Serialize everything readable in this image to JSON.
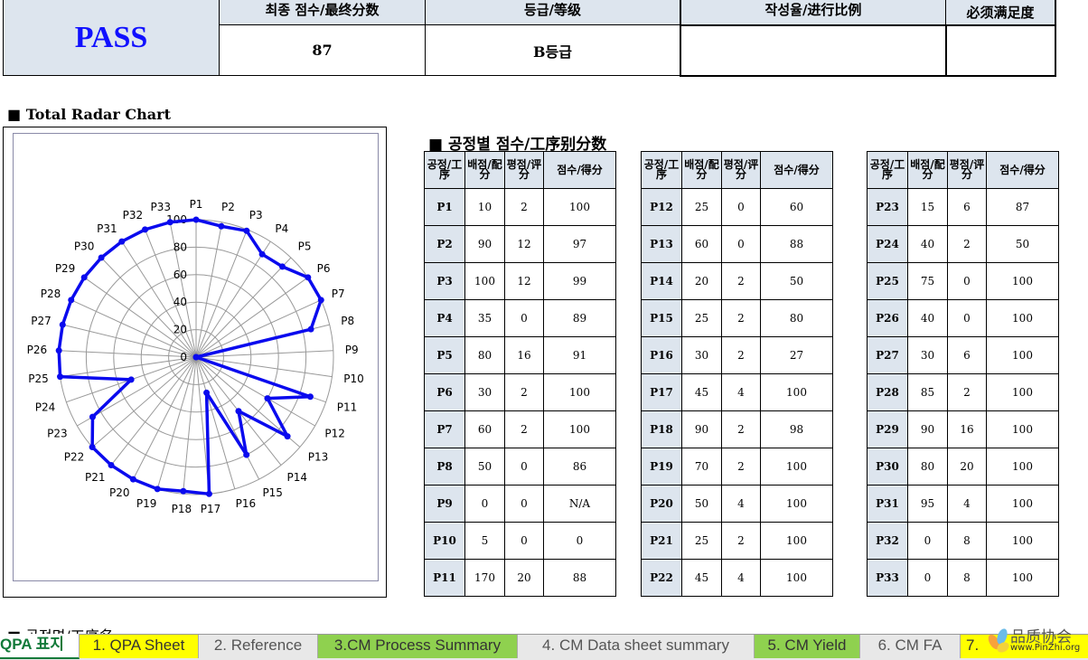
{
  "header": {
    "result": "PASS",
    "columns": [
      "최종 점수/最终分数",
      "등급/等级",
      "작성율/进行比例",
      "必须满足度"
    ],
    "values": [
      "87",
      "B등급",
      "",
      ""
    ]
  },
  "radar_title": "■ Total Radar Chart",
  "score_title": "■ 공정별 점수/工序别分数",
  "next_section": "■ 공정명/工序名",
  "table_headers": [
    "공정/工序",
    "배점/配分",
    "평점/评分",
    "점수/得分"
  ],
  "rows": [
    [
      "P1",
      "10",
      "2",
      "100"
    ],
    [
      "P2",
      "90",
      "12",
      "97"
    ],
    [
      "P3",
      "100",
      "12",
      "99"
    ],
    [
      "P4",
      "35",
      "0",
      "89"
    ],
    [
      "P5",
      "80",
      "16",
      "91"
    ],
    [
      "P6",
      "30",
      "2",
      "100"
    ],
    [
      "P7",
      "60",
      "2",
      "100"
    ],
    [
      "P8",
      "50",
      "0",
      "86"
    ],
    [
      "P9",
      "0",
      "0",
      "N/A"
    ],
    [
      "P10",
      "5",
      "0",
      "0"
    ],
    [
      "P11",
      "170",
      "20",
      "88"
    ],
    [
      "P12",
      "25",
      "0",
      "60"
    ],
    [
      "P13",
      "60",
      "0",
      "88"
    ],
    [
      "P14",
      "20",
      "2",
      "50"
    ],
    [
      "P15",
      "25",
      "2",
      "80"
    ],
    [
      "P16",
      "30",
      "2",
      "27"
    ],
    [
      "P17",
      "45",
      "4",
      "100"
    ],
    [
      "P18",
      "90",
      "2",
      "98"
    ],
    [
      "P19",
      "70",
      "2",
      "100"
    ],
    [
      "P20",
      "50",
      "4",
      "100"
    ],
    [
      "P21",
      "25",
      "2",
      "100"
    ],
    [
      "P22",
      "45",
      "4",
      "100"
    ],
    [
      "P23",
      "15",
      "6",
      "87"
    ],
    [
      "P24",
      "40",
      "2",
      "50"
    ],
    [
      "P25",
      "75",
      "0",
      "100"
    ],
    [
      "P26",
      "40",
      "0",
      "100"
    ],
    [
      "P27",
      "30",
      "6",
      "100"
    ],
    [
      "P28",
      "85",
      "2",
      "100"
    ],
    [
      "P29",
      "90",
      "16",
      "100"
    ],
    [
      "P30",
      "80",
      "20",
      "100"
    ],
    [
      "P31",
      "95",
      "4",
      "100"
    ],
    [
      "P32",
      "0",
      "8",
      "100"
    ],
    [
      "P33",
      "0",
      "8",
      "100"
    ]
  ],
  "chart_data": {
    "type": "radar",
    "categories": [
      "P1",
      "P2",
      "P3",
      "P4",
      "P5",
      "P6",
      "P7",
      "P8",
      "P9",
      "P10",
      "P11",
      "P12",
      "P13",
      "P14",
      "P15",
      "P16",
      "P17",
      "P18",
      "P19",
      "P20",
      "P21",
      "P22",
      "P23",
      "P24",
      "P25",
      "P26",
      "P27",
      "P28",
      "P29",
      "P30",
      "P31",
      "P32",
      "P33"
    ],
    "values": [
      100,
      97,
      99,
      89,
      91,
      100,
      100,
      86,
      0,
      0,
      88,
      60,
      88,
      50,
      80,
      27,
      100,
      98,
      100,
      100,
      100,
      100,
      87,
      50,
      100,
      100,
      100,
      100,
      100,
      100,
      100,
      100,
      100
    ],
    "rlim": [
      0,
      100
    ],
    "ticks": [
      "0",
      "20",
      "40",
      "60",
      "80",
      "100"
    ],
    "grid": true,
    "line_color": "#0a0aee"
  },
  "tabs": [
    {
      "label": "QPA 표지",
      "bg": "#ffffff",
      "color": "#137a3a",
      "active": true
    },
    {
      "label": "1. QPA Sheet",
      "bg": "#ffff00",
      "color": "#333333"
    },
    {
      "label": "2. Reference",
      "bg": "#e8e8e8",
      "color": "#555555"
    },
    {
      "label": "3.CM Process Summary",
      "bg": "#8fd14f",
      "color": "#333333"
    },
    {
      "label": "4. CM Data sheet summary",
      "bg": "#e8e8e8",
      "color": "#555555"
    },
    {
      "label": "5. CM Yield",
      "bg": "#8fd14f",
      "color": "#333333"
    },
    {
      "label": "6. CM FA",
      "bg": "#e8e8e8",
      "color": "#555555"
    },
    {
      "label": "7.",
      "bg": "#ffff00",
      "color": "#333333"
    }
  ],
  "watermark": {
    "text": "品质协会",
    "url": "www.PinZhi.org"
  }
}
